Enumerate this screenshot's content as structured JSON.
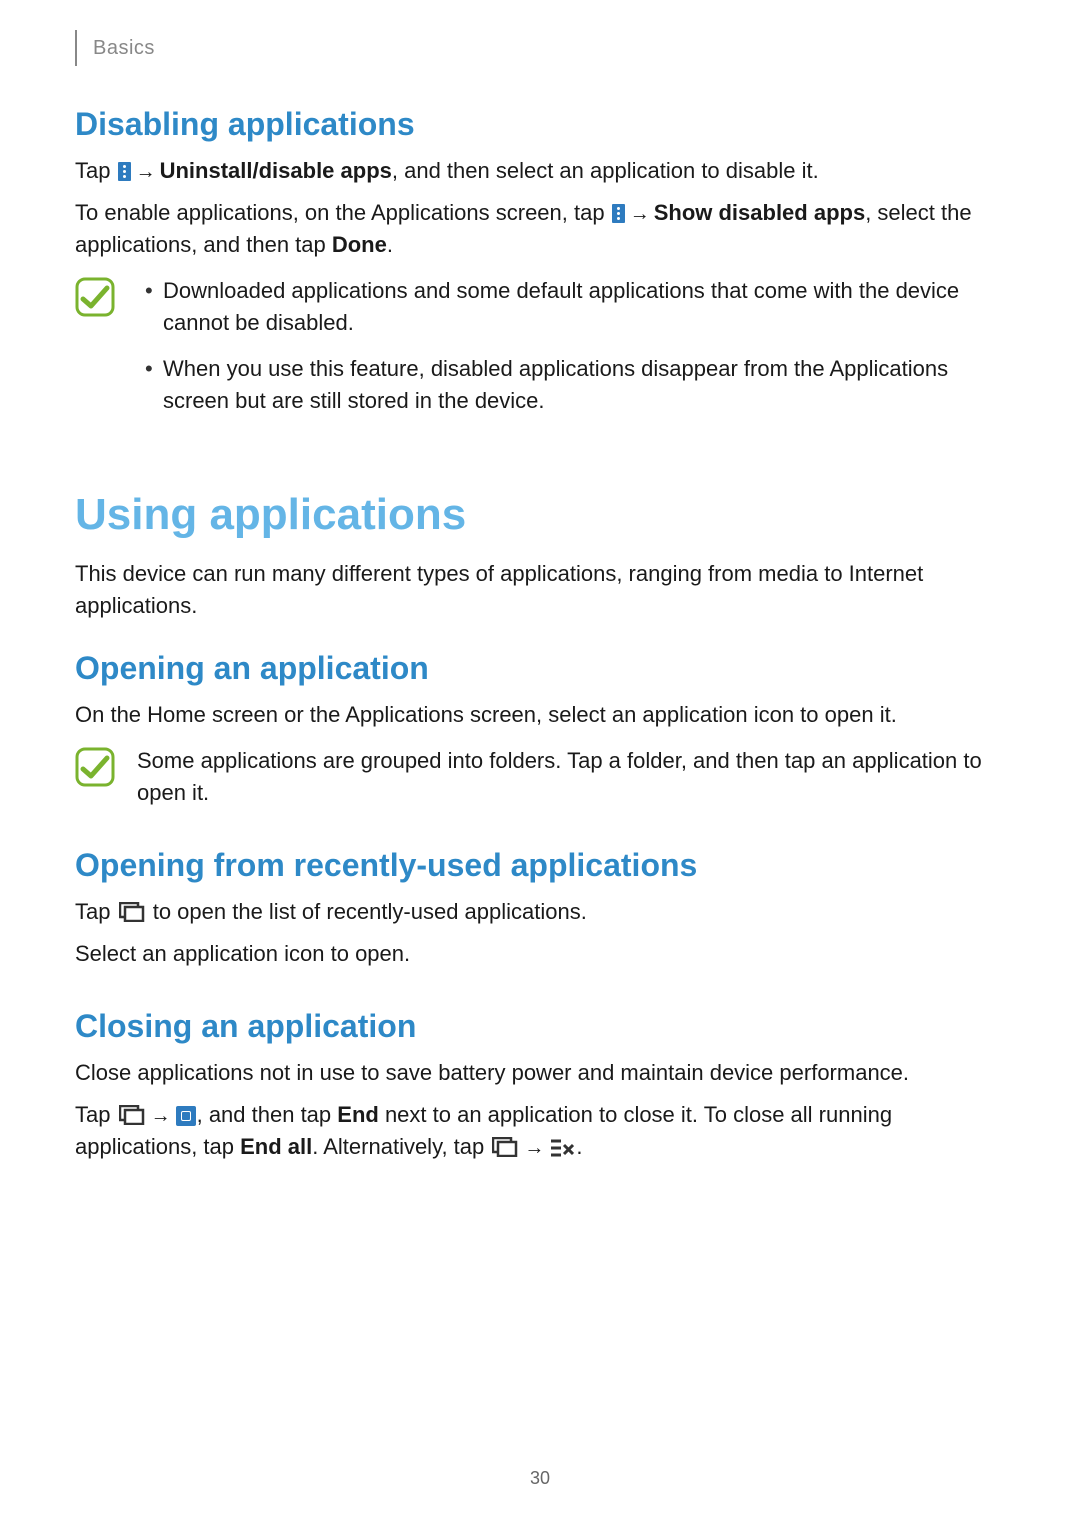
{
  "header": {
    "breadcrumb": "Basics"
  },
  "s1": {
    "title": "Disabling applications",
    "p1_a": "Tap ",
    "p1_b": " → ",
    "p1_bold": "Uninstall/disable apps",
    "p1_c": ", and then select an application to disable it.",
    "p2_a": "To enable applications, on the Applications screen, tap ",
    "p2_b": " → ",
    "p2_bold": "Show disabled apps",
    "p2_c": ", select the applications, and then tap ",
    "p2_done": "Done",
    "p2_end": ".",
    "note1": "Downloaded applications and some default applications that come with the device cannot be disabled.",
    "note2": "When you use this feature, disabled applications disappear from the Applications screen but are still stored in the device."
  },
  "s2": {
    "title": "Using applications",
    "intro": "This device can run many different types of applications, ranging from media to Internet applications."
  },
  "s3": {
    "title": "Opening an application",
    "p1": "On the Home screen or the Applications screen, select an application icon to open it.",
    "note": "Some applications are grouped into folders. Tap a folder, and then tap an application to open it."
  },
  "s4": {
    "title": "Opening from recently-used applications",
    "p1_a": "Tap ",
    "p1_b": " to open the list of recently-used applications.",
    "p2": "Select an application icon to open."
  },
  "s5": {
    "title": "Closing an application",
    "p1": "Close applications not in use to save battery power and maintain device performance.",
    "p2_a": "Tap ",
    "p2_b": " → ",
    "p2_c": ", and then tap ",
    "p2_end": "End",
    "p2_d": " next to an application to close it. To close all running applications, tap ",
    "p2_endall": "End all",
    "p2_e": ". Alternatively, tap ",
    "p2_f": " → ",
    "p2_g": "."
  },
  "footer": {
    "page": "30"
  }
}
